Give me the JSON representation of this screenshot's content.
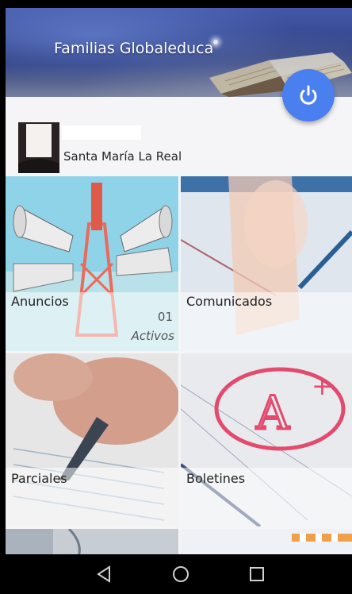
{
  "header": {
    "title": "Familias Globaleduca",
    "power_icon": "power-icon",
    "accent_color": "#4a7ff0"
  },
  "profile": {
    "school": "Santa María La Real"
  },
  "tiles": [
    {
      "label": "Anuncios",
      "count": "01",
      "status": "Activos"
    },
    {
      "label": "Comunicados"
    },
    {
      "label": "Parciales"
    },
    {
      "label": "Boletines"
    }
  ],
  "navbar": {
    "back_icon": "back-triangle-icon",
    "home_icon": "home-circle-icon",
    "recents_icon": "recents-square-icon"
  }
}
